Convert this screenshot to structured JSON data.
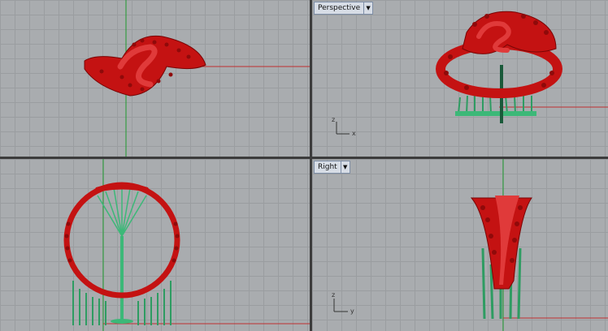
{
  "viewports": {
    "top": {
      "label": ""
    },
    "perspective": {
      "label": "Perspective"
    },
    "front": {
      "label": ""
    },
    "right": {
      "label": "Right"
    }
  },
  "axes": {
    "perspective": {
      "x": "x",
      "z": "z"
    },
    "right": {
      "y": "y",
      "z": "z"
    }
  },
  "colors": {
    "grid_bg": "#a9acaf",
    "ring_red": "#c01010",
    "support_green": "#3cb878",
    "axis_red": "#c03030",
    "axis_green": "#1f9a2f"
  },
  "icons": {
    "dropdown": "chevron-down-icon"
  }
}
